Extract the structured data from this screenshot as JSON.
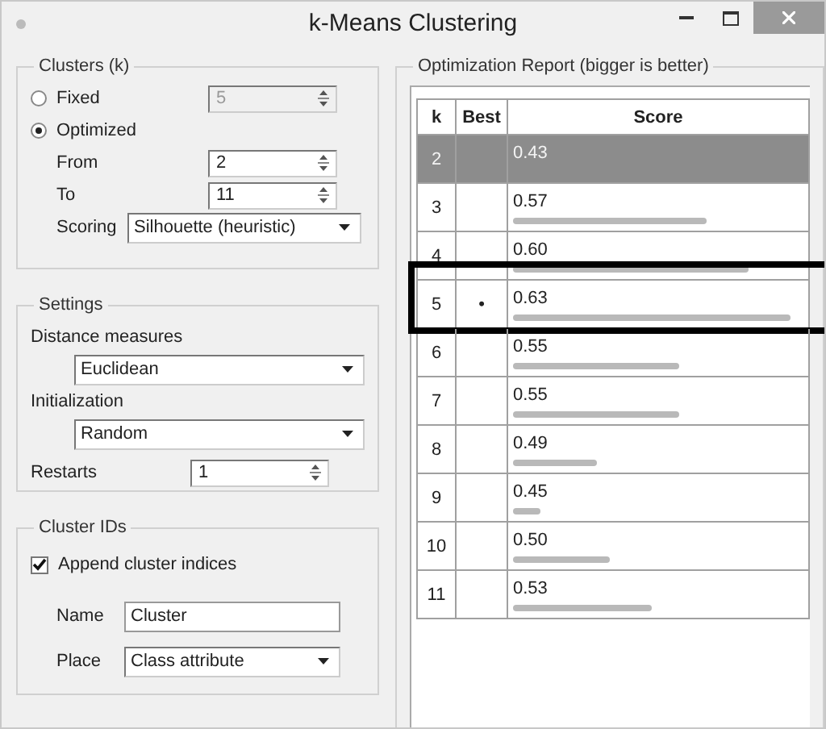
{
  "window": {
    "title": "k-Means Clustering"
  },
  "clusters": {
    "title": "Clusters (k)",
    "options": [
      {
        "label": "Fixed",
        "selected": false,
        "value": "5"
      },
      {
        "label": "Optimized",
        "selected": true
      }
    ],
    "from": {
      "label": "From",
      "value": "2"
    },
    "to": {
      "label": "To",
      "value": "11"
    },
    "scoring": {
      "label": "Scoring",
      "value": "Silhouette (heuristic)"
    }
  },
  "settings": {
    "title": "Settings",
    "distance": {
      "label": "Distance measures",
      "value": "Euclidean"
    },
    "initialization": {
      "label": "Initialization",
      "value": "Random"
    },
    "restarts": {
      "label": "Restarts",
      "value": "1"
    }
  },
  "cluster_ids": {
    "title": "Cluster IDs",
    "append": {
      "label": "Append cluster indices",
      "checked": true
    },
    "name": {
      "label": "Name",
      "value": "Cluster"
    },
    "place": {
      "label": "Place",
      "value": "Class attribute"
    }
  },
  "report": {
    "title": "Optimization Report (bigger is better)",
    "columns": [
      "k",
      "Best",
      "Score"
    ],
    "rows": [
      {
        "k": "2",
        "score": "0.43",
        "selected": true,
        "outlined": false
      },
      {
        "k": "3",
        "score": "0.57",
        "level": 0.7,
        "selected": false,
        "outlined": false
      },
      {
        "k": "4",
        "score": "0.60",
        "level": 0.85,
        "selected": false,
        "outlined": false
      },
      {
        "k": "5",
        "best": "•",
        "score": "0.63",
        "level": 1,
        "selected": false,
        "outlined": true
      },
      {
        "k": "6",
        "score": "0.55",
        "level": 0.6,
        "selected": false,
        "outlined": false
      },
      {
        "k": "7",
        "score": "0.55",
        "level": 0.6,
        "selected": false,
        "outlined": false
      },
      {
        "k": "8",
        "score": "0.49",
        "level": 0.3,
        "selected": false,
        "outlined": false
      },
      {
        "k": "9",
        "score": "0.45",
        "level": 0.1,
        "selected": false,
        "outlined": false
      },
      {
        "k": "10",
        "score": "0.50",
        "level": 0.35,
        "selected": false,
        "outlined": false
      },
      {
        "k": "11",
        "score": "0.53",
        "level": 0.5,
        "selected": false,
        "outlined": false
      }
    ]
  }
}
